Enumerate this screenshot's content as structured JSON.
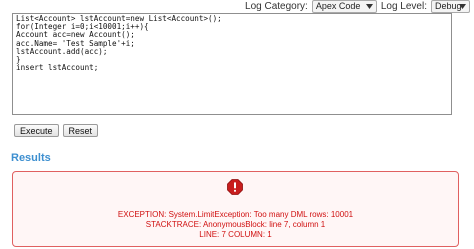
{
  "toolbar": {
    "log_category_label": "Log Category:",
    "log_category_value": "Apex Code",
    "log_level_label": "Log Level:",
    "log_level_value": "Debug"
  },
  "editor": {
    "lines": [
      "List<Account> lstAccount=new List<Account>();",
      "for(Integer i=0;i<10001;i++){",
      "Account acc=new Account();",
      "acc.Name= 'Test Sample'+i;",
      "lstAccount.add(acc);",
      "}",
      "insert lstAccount;"
    ]
  },
  "buttons": {
    "execute_label": "Execute",
    "reset_label": "Reset"
  },
  "results": {
    "heading": "Results",
    "exception_line": "EXCEPTION: System.LimitException: Too many DML rows: 10001",
    "stacktrace_line": "STACKTRACE: AnonymousBlock: line 7, column 1",
    "position_line": "LINE: 7 COLUMN: 1"
  },
  "colors": {
    "results_heading": "#3d8fd0",
    "error_text": "#d01010",
    "error_border": "#e06060",
    "error_icon": "#c81e1e"
  }
}
